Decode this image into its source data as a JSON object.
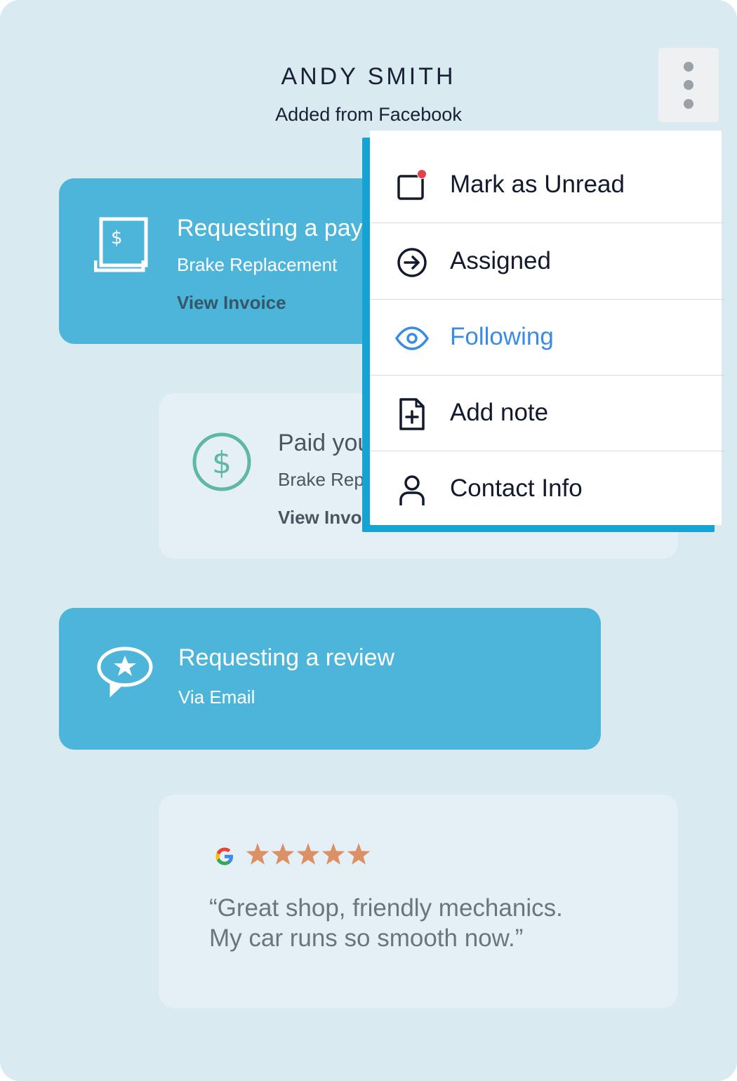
{
  "contact": {
    "name": "ANDY SMITH",
    "source": "Added from Facebook"
  },
  "menu": {
    "items": [
      {
        "label": "Mark as Unread",
        "icon": "mark-unread-icon"
      },
      {
        "label": "Assigned",
        "icon": "arrow-circle-right-icon"
      },
      {
        "label": "Following",
        "icon": "eye-icon",
        "active": true
      },
      {
        "label": "Add note",
        "icon": "note-add-icon"
      },
      {
        "label": "Contact Info",
        "icon": "user-icon"
      }
    ]
  },
  "cards": {
    "payment_request": {
      "title": "Requesting a payment",
      "subtitle": "Brake Replacement",
      "link": "View Invoice",
      "icon": "invoice-icon"
    },
    "payment_paid": {
      "title": "Paid your invoice",
      "subtitle": "Brake Replacement",
      "link": "View Invoice",
      "icon": "dollar-circle-icon"
    },
    "review_request": {
      "title": "Requesting a review",
      "subtitle": "Via Email",
      "icon": "star-speech-bubble-icon"
    },
    "review": {
      "source_icon": "google-icon",
      "rating": 5,
      "text": "“Great shop, friendly mechanics.\nMy car runs so smooth now.”"
    }
  },
  "colors": {
    "background": "#d9eaf0",
    "card_blue": "#4db5d9",
    "card_light": "#e4f0f5",
    "menu_accent": "#14a3d3",
    "active": "#3b8be6",
    "star": "#dc9066",
    "unread_dot": "#e0444b",
    "dollar_green": "#5fb8a5"
  }
}
